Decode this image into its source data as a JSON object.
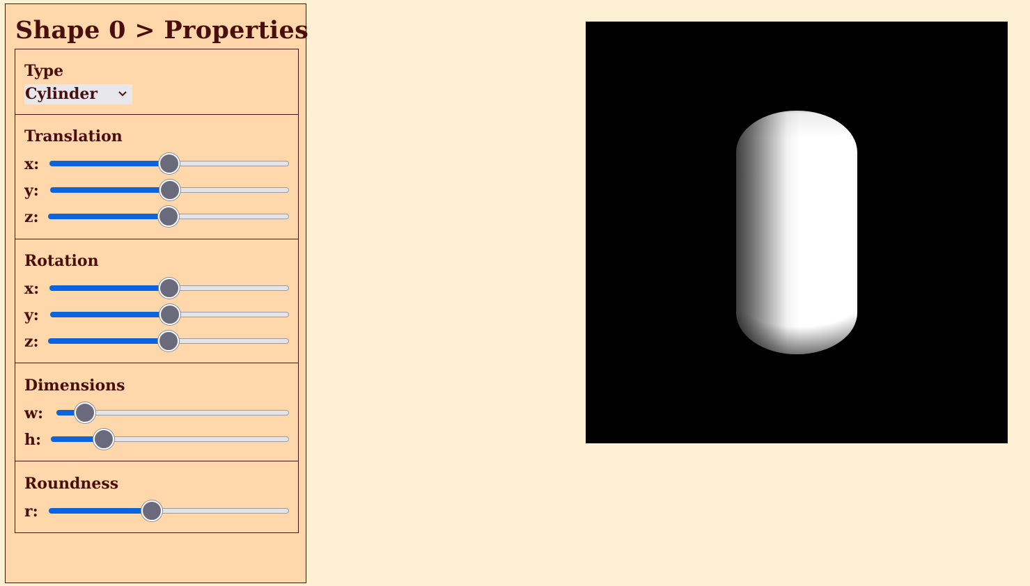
{
  "panel": {
    "title": "Shape 0 > Properties"
  },
  "type_section": {
    "label": "Type",
    "selected": "Cylinder"
  },
  "translation": {
    "label": "Translation",
    "sliders": [
      {
        "axis": "x:",
        "value": 0.5
      },
      {
        "axis": "y:",
        "value": 0.5
      },
      {
        "axis": "z:",
        "value": 0.5
      }
    ]
  },
  "rotation": {
    "label": "Rotation",
    "sliders": [
      {
        "axis": "x:",
        "value": 0.5
      },
      {
        "axis": "y:",
        "value": 0.5
      },
      {
        "axis": "z:",
        "value": 0.5
      }
    ]
  },
  "dimensions": {
    "label": "Dimensions",
    "sliders": [
      {
        "axis": "w:",
        "value": 0.12
      },
      {
        "axis": "h:",
        "value": 0.22
      }
    ]
  },
  "roundness": {
    "label": "Roundness",
    "sliders": [
      {
        "axis": "r:",
        "value": 0.43
      }
    ]
  },
  "colors": {
    "panel_bg": "#fed8aa",
    "page_bg": "#fef1d3",
    "text": "#4a0e0e",
    "slider_fill": "#0b63e0",
    "slider_thumb": "#6a6a7c",
    "viewport_bg": "#000000"
  },
  "viewport": {
    "shape": "capsule-cylinder",
    "shading": "white-lit"
  }
}
